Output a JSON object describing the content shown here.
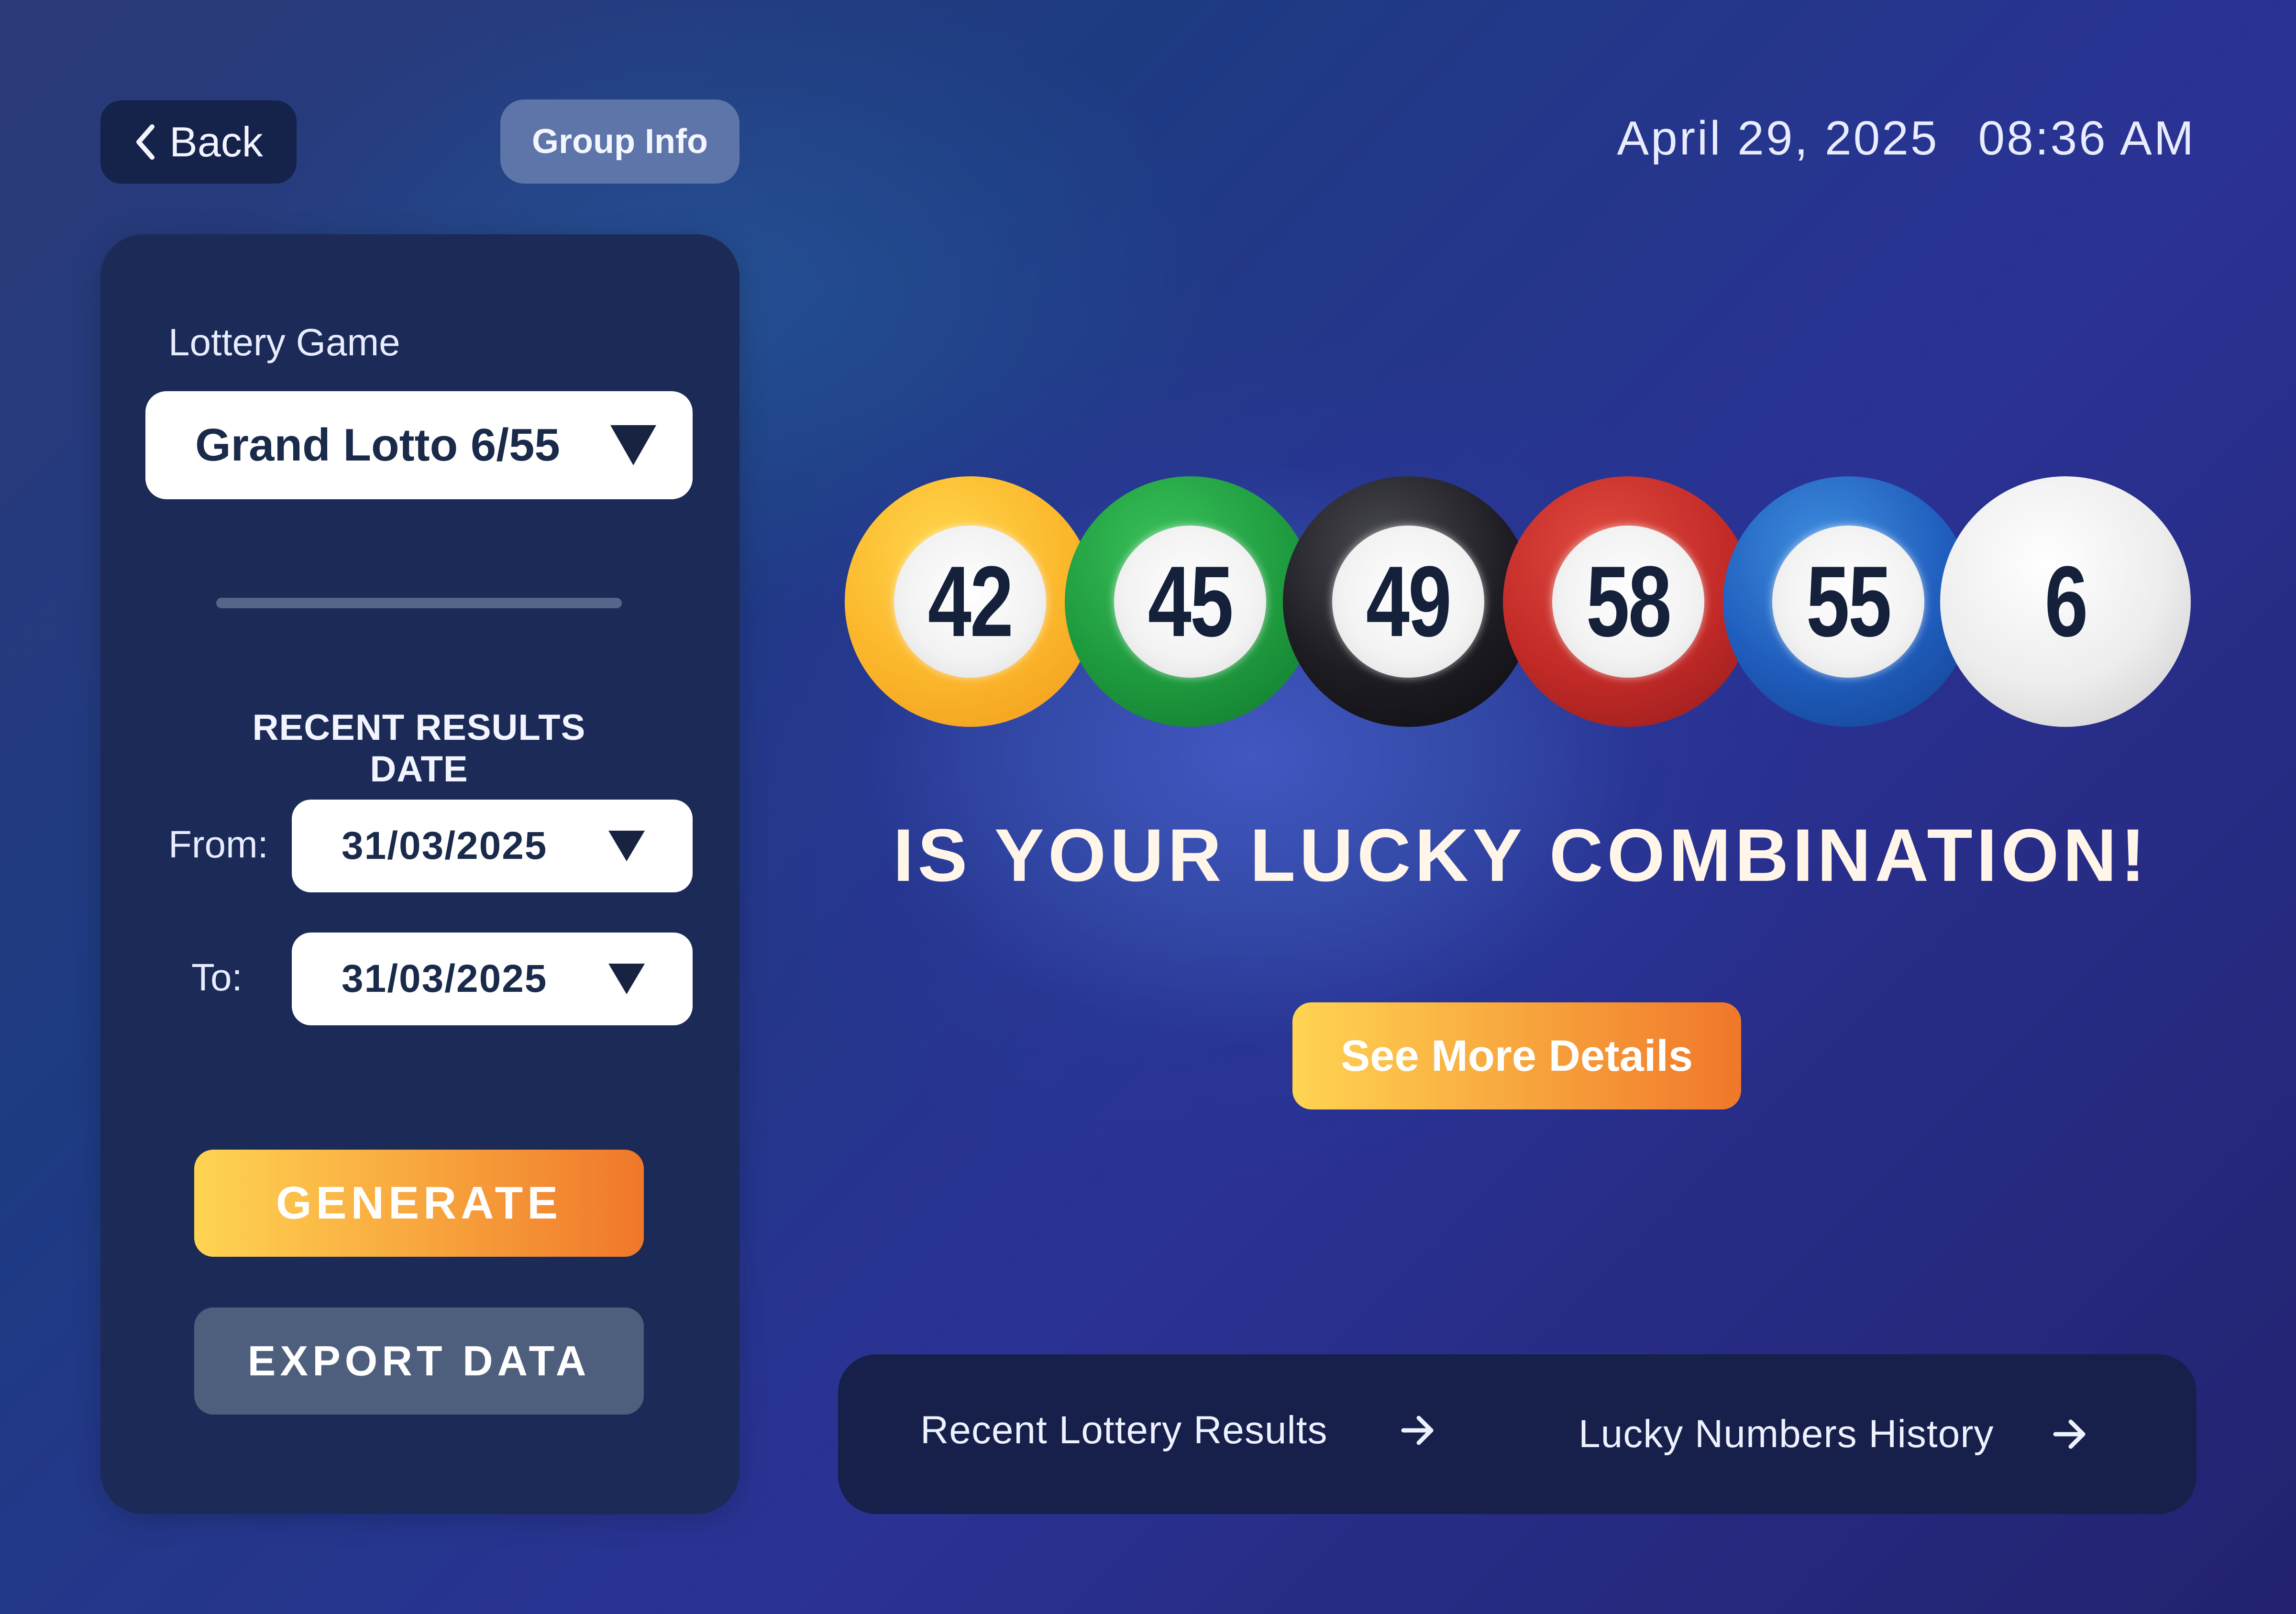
{
  "header": {
    "back_label": "Back",
    "group_info_label": "Group Info",
    "date": "April 29, 2025",
    "time": "08:36 AM"
  },
  "sidebar": {
    "game_label": "Lottery Game",
    "game_value": "Grand Lotto 6/55",
    "recent_results_label": "RECENT RESULTS DATE",
    "from_label": "From:",
    "from_value": "31/03/2025",
    "to_label": "To:",
    "to_value": "31/03/2025",
    "generate_label": "GENERATE",
    "export_label": "EXPORT DATA"
  },
  "main": {
    "balls": [
      {
        "number": "42",
        "color": "#fbb62b"
      },
      {
        "number": "45",
        "color": "#1e9a3e"
      },
      {
        "number": "49",
        "color": "#1c1c22"
      },
      {
        "number": "58",
        "color": "#c22a27"
      },
      {
        "number": "55",
        "color": "#1f5cbc"
      },
      {
        "number": "6",
        "color": "#ededed"
      }
    ],
    "headline": "IS YOUR LUCKY COMBINATION!",
    "details_label": "See More Details"
  },
  "links": {
    "recent_results_label": "Recent Lottery Results",
    "history_label": "Lucky Numbers History",
    "arrow_icon": "arrow-right-icon"
  },
  "colors": {
    "accent_start": "#ffd452",
    "accent_end": "#f0772a",
    "panel": "#1b2a57"
  }
}
